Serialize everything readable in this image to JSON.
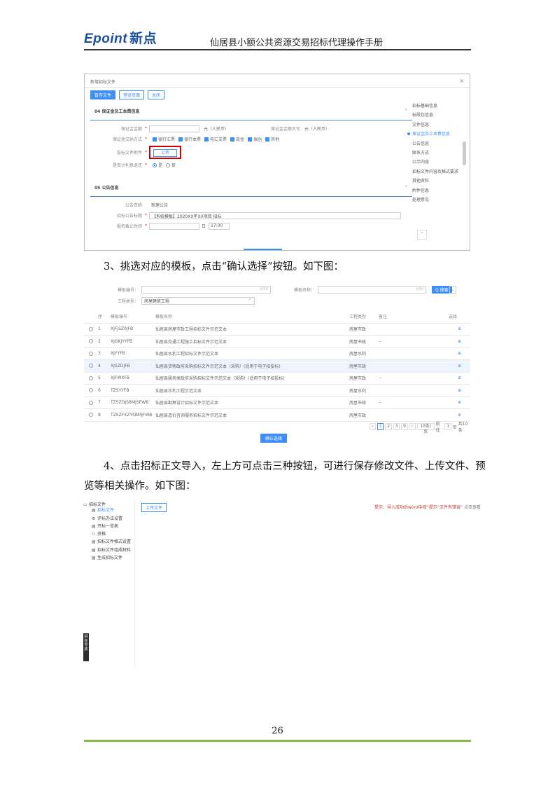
{
  "header": {
    "logo_latin": "Epoint",
    "logo_cn": "新点",
    "title": "仙居县小额公共资源交易招标代理操作手册"
  },
  "shot1": {
    "window_title": "新增招标文件",
    "close_glyph": "×",
    "toolbar": [
      "暂存文件",
      "预览页面",
      "关闭"
    ],
    "section4": {
      "title": "04 保证金及工本费信息",
      "deposit_label": "保证金金额",
      "deposit_unit": "元（人民币）",
      "deposit_cap_label": "保证金金额大写",
      "deposit_cap_unit": "元（人民币）",
      "pay_methods_label": "保证金交纳方式",
      "pay_methods": [
        "银行汇票",
        "银行本票",
        "电汇支票",
        "现金",
        "保函",
        "其他"
      ],
      "attach_label": "投标文件附件",
      "attach_btn": "上传",
      "refund_label": "是否计利息退还",
      "refund_yes": "是",
      "refund_no": "否"
    },
    "section5": {
      "title": "05 公告信息",
      "template_label": "公告名称",
      "template_value": "新建公告",
      "announce_label": "招标公告标题",
      "announce_value": "【系统模板】2020XX年XX项目 招标",
      "date_label": "报名截止时间",
      "date_unit": "日",
      "time_value": "17:00"
    },
    "side_nav": [
      "招标基础信息",
      "标段包信息",
      "文件信息",
      "保证金及工本费信息",
      "公告信息",
      "联系方式",
      "公示内容",
      "招标文件内容及格式要求",
      "其他资料",
      "附件信息",
      "处理意见"
    ],
    "side_active": 3,
    "scroll_up_glyph": "^"
  },
  "step3": "3、挑选对应的模板，点击“确认选择”按钮。如下图：",
  "shot2": {
    "search_code_label": "模板编号：",
    "search_name_label": "模板名称：",
    "search_type_label": "工程类型：",
    "search_type_value": "房屋建筑工程",
    "count_hint": "0/50",
    "search_btn": "Q 搜索",
    "more_glyph": "⌄",
    "columns": [
      "",
      "序",
      "模板编号",
      "模板名称",
      "工程类型",
      "备注",
      "选择"
    ],
    "rows": [
      {
        "idx": "1",
        "code": "XJFJSZ0JFB",
        "name": "仙居县房屋市政工程招标文件示范文本",
        "type": "房屋市政",
        "note": "",
        "op": "⊕"
      },
      {
        "idx": "2",
        "code": "XJGKJYYFB",
        "name": "仙居县交通工程施工招标文件示范文本",
        "type": "房屋市政",
        "note": "--",
        "op": "⊕"
      },
      {
        "idx": "3",
        "code": "XJYYFB",
        "name": "仙居县水利工程招标文件示范文本",
        "type": "房屋水利",
        "note": "",
        "op": "⊕"
      },
      {
        "idx": "4",
        "code": "XJSZDJFB",
        "name": "仙居县货物政府采购招标文件示范文本（采购）(适用于电子招投标)",
        "type": "房屋市政",
        "note": "",
        "op": "⊕"
      },
      {
        "idx": "5",
        "code": "XJFWXFB",
        "name": "仙居县服务类政府采购招标文件示范文本（采购）(适用于电子招投标)",
        "type": "房屋市政",
        "note": "--",
        "op": "⊕"
      },
      {
        "idx": "6",
        "code": "TZSYYFB",
        "name": "仙居县水利工程示范文本",
        "type": "房屋水利",
        "note": "",
        "op": "⊕"
      },
      {
        "idx": "7",
        "code": "TZSZDJSBMJSFWB",
        "name": "仙居县勘察设计招标文件示范文本",
        "type": "房屋市政",
        "note": "--",
        "op": "⊕"
      },
      {
        "idx": "8",
        "code": "TZSZFXZYSBMJFWB",
        "name": "仙居县造价咨询服务招标文件示范文本",
        "type": "房屋市政",
        "note": "",
        "op": "⊕"
      }
    ],
    "highlight_row": 3,
    "pager": [
      "‹",
      "1",
      "2",
      "3",
      "9",
      "›",
      "10条/页",
      "前往",
      "1",
      "页",
      "共10条"
    ],
    "confirm_btn": "确认选择"
  },
  "step4": {
    "line1": "4、点击招标正文导入，左上方可点击三种按钮，可进行保存修改文件、上传文件、预",
    "line2": "览等相关操作。如下图："
  },
  "shot3": {
    "tree_root": "招标文件",
    "tree_items": [
      {
        "icon": "▤",
        "label": "招标文件"
      },
      {
        "icon": "⚙",
        "label": "评标办法设置"
      },
      {
        "icon": "▤",
        "label": "开标一览表"
      },
      {
        "icon": "⚇",
        "label": "资格"
      },
      {
        "icon": "▤",
        "label": "招标文件格式设置"
      },
      {
        "icon": "▤",
        "label": "招标文件组成材料"
      },
      {
        "icon": "▤",
        "label": "生成招标文件"
      }
    ],
    "upload_btn": "上传文件",
    "hint_red": "提示：导入成功后word中按“提示“文件有错误”",
    "hint_gray": "点击查看",
    "float_label": "招标导航"
  },
  "footer": {
    "page_number": "26"
  }
}
